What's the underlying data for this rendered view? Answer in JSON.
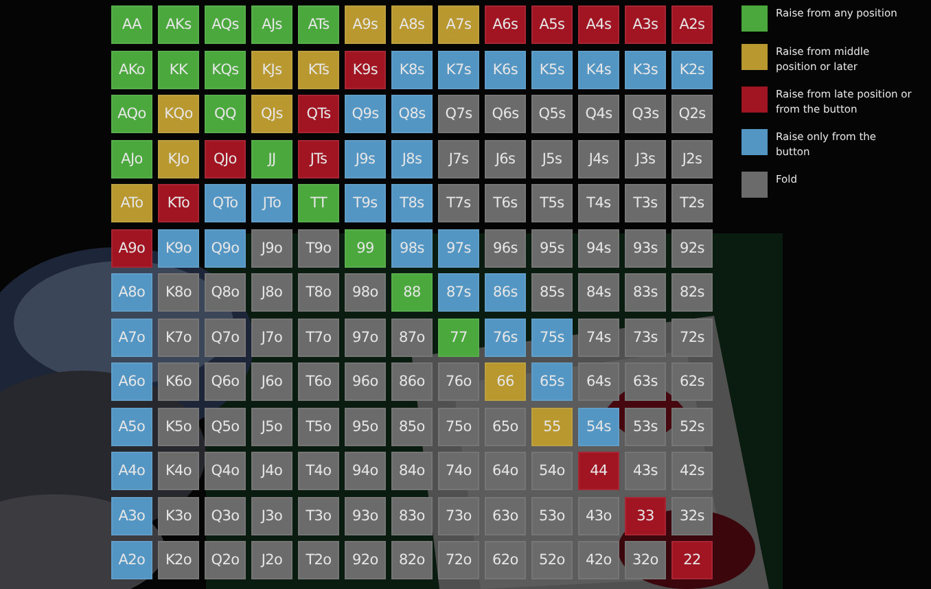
{
  "legend": [
    {
      "label": "Raise from any position",
      "color": "#4aa83d"
    },
    {
      "label": "Raise from middle position or later",
      "color": "#b8982f"
    },
    {
      "label": "Raise from late position or from the button",
      "color": "#a11422"
    },
    {
      "label": "Raise only from the button",
      "color": "#5496c3"
    },
    {
      "label": "Fold",
      "color": "#6b6b6b"
    }
  ],
  "grid": [
    [
      {
        "label": "AA",
        "color": "#4aa83d"
      },
      {
        "label": "AKs",
        "color": "#4aa83d"
      },
      {
        "label": "AQs",
        "color": "#4aa83d"
      },
      {
        "label": "AJs",
        "color": "#4aa83d"
      },
      {
        "label": "ATs",
        "color": "#4aa83d"
      },
      {
        "label": "A9s",
        "color": "#b8982f"
      },
      {
        "label": "A8s",
        "color": "#b8982f"
      },
      {
        "label": "A7s",
        "color": "#b8982f"
      },
      {
        "label": "A6s",
        "color": "#a11422"
      },
      {
        "label": "A5s",
        "color": "#a11422"
      },
      {
        "label": "A4s",
        "color": "#a11422"
      },
      {
        "label": "A3s",
        "color": "#a11422"
      },
      {
        "label": "A2s",
        "color": "#a11422"
      }
    ],
    [
      {
        "label": "AKo",
        "color": "#4aa83d"
      },
      {
        "label": "KK",
        "color": "#4aa83d"
      },
      {
        "label": "KQs",
        "color": "#4aa83d"
      },
      {
        "label": "KJs",
        "color": "#b8982f"
      },
      {
        "label": "KTs",
        "color": "#b8982f"
      },
      {
        "label": "K9s",
        "color": "#a11422"
      },
      {
        "label": "K8s",
        "color": "#5496c3"
      },
      {
        "label": "K7s",
        "color": "#5496c3"
      },
      {
        "label": "K6s",
        "color": "#5496c3"
      },
      {
        "label": "K5s",
        "color": "#5496c3"
      },
      {
        "label": "K4s",
        "color": "#5496c3"
      },
      {
        "label": "K3s",
        "color": "#5496c3"
      },
      {
        "label": "K2s",
        "color": "#5496c3"
      }
    ],
    [
      {
        "label": "AQo",
        "color": "#4aa83d"
      },
      {
        "label": "KQo",
        "color": "#b8982f"
      },
      {
        "label": "QQ",
        "color": "#4aa83d"
      },
      {
        "label": "QJs",
        "color": "#b8982f"
      },
      {
        "label": "QTs",
        "color": "#a11422"
      },
      {
        "label": "Q9s",
        "color": "#5496c3"
      },
      {
        "label": "Q8s",
        "color": "#5496c3"
      },
      {
        "label": "Q7s",
        "color": "#6b6b6b"
      },
      {
        "label": "Q6s",
        "color": "#6b6b6b"
      },
      {
        "label": "Q5s",
        "color": "#6b6b6b"
      },
      {
        "label": "Q4s",
        "color": "#6b6b6b"
      },
      {
        "label": "Q3s",
        "color": "#6b6b6b"
      },
      {
        "label": "Q2s",
        "color": "#6b6b6b"
      }
    ],
    [
      {
        "label": "AJo",
        "color": "#4aa83d"
      },
      {
        "label": "KJo",
        "color": "#b8982f"
      },
      {
        "label": "QJo",
        "color": "#a11422"
      },
      {
        "label": "JJ",
        "color": "#4aa83d"
      },
      {
        "label": "JTs",
        "color": "#a11422"
      },
      {
        "label": "J9s",
        "color": "#5496c3"
      },
      {
        "label": "J8s",
        "color": "#5496c3"
      },
      {
        "label": "J7s",
        "color": "#6b6b6b"
      },
      {
        "label": "J6s",
        "color": "#6b6b6b"
      },
      {
        "label": "J5s",
        "color": "#6b6b6b"
      },
      {
        "label": "J4s",
        "color": "#6b6b6b"
      },
      {
        "label": "J3s",
        "color": "#6b6b6b"
      },
      {
        "label": "J2s",
        "color": "#6b6b6b"
      }
    ],
    [
      {
        "label": "ATo",
        "color": "#b8982f"
      },
      {
        "label": "KTo",
        "color": "#a11422"
      },
      {
        "label": "QTo",
        "color": "#5496c3"
      },
      {
        "label": "JTo",
        "color": "#5496c3"
      },
      {
        "label": "TT",
        "color": "#4aa83d"
      },
      {
        "label": "T9s",
        "color": "#5496c3"
      },
      {
        "label": "T8s",
        "color": "#5496c3"
      },
      {
        "label": "T7s",
        "color": "#6b6b6b"
      },
      {
        "label": "T6s",
        "color": "#6b6b6b"
      },
      {
        "label": "T5s",
        "color": "#6b6b6b"
      },
      {
        "label": "T4s",
        "color": "#6b6b6b"
      },
      {
        "label": "T3s",
        "color": "#6b6b6b"
      },
      {
        "label": "T2s",
        "color": "#6b6b6b"
      }
    ],
    [
      {
        "label": "A9o",
        "color": "#a11422"
      },
      {
        "label": "K9o",
        "color": "#5496c3"
      },
      {
        "label": "Q9o",
        "color": "#5496c3"
      },
      {
        "label": "J9o",
        "color": "#6b6b6b"
      },
      {
        "label": "T9o",
        "color": "#6b6b6b"
      },
      {
        "label": "99",
        "color": "#4aa83d"
      },
      {
        "label": "98s",
        "color": "#5496c3"
      },
      {
        "label": "97s",
        "color": "#5496c3"
      },
      {
        "label": "96s",
        "color": "#6b6b6b"
      },
      {
        "label": "95s",
        "color": "#6b6b6b"
      },
      {
        "label": "94s",
        "color": "#6b6b6b"
      },
      {
        "label": "93s",
        "color": "#6b6b6b"
      },
      {
        "label": "92s",
        "color": "#6b6b6b"
      }
    ],
    [
      {
        "label": "A8o",
        "color": "#5496c3"
      },
      {
        "label": "K8o",
        "color": "#6b6b6b"
      },
      {
        "label": "Q8o",
        "color": "#6b6b6b"
      },
      {
        "label": "J8o",
        "color": "#6b6b6b"
      },
      {
        "label": "T8o",
        "color": "#6b6b6b"
      },
      {
        "label": "98o",
        "color": "#6b6b6b"
      },
      {
        "label": "88",
        "color": "#4aa83d"
      },
      {
        "label": "87s",
        "color": "#5496c3"
      },
      {
        "label": "86s",
        "color": "#5496c3"
      },
      {
        "label": "85s",
        "color": "#6b6b6b"
      },
      {
        "label": "84s",
        "color": "#6b6b6b"
      },
      {
        "label": "83s",
        "color": "#6b6b6b"
      },
      {
        "label": "82s",
        "color": "#6b6b6b"
      }
    ],
    [
      {
        "label": "A7o",
        "color": "#5496c3"
      },
      {
        "label": "K7o",
        "color": "#6b6b6b"
      },
      {
        "label": "Q7o",
        "color": "#6b6b6b"
      },
      {
        "label": "J7o",
        "color": "#6b6b6b"
      },
      {
        "label": "T7o",
        "color": "#6b6b6b"
      },
      {
        "label": "97o",
        "color": "#6b6b6b"
      },
      {
        "label": "87o",
        "color": "#6b6b6b"
      },
      {
        "label": "77",
        "color": "#4aa83d"
      },
      {
        "label": "76s",
        "color": "#5496c3"
      },
      {
        "label": "75s",
        "color": "#5496c3"
      },
      {
        "label": "74s",
        "color": "#6b6b6b"
      },
      {
        "label": "73s",
        "color": "#6b6b6b"
      },
      {
        "label": "72s",
        "color": "#6b6b6b"
      }
    ],
    [
      {
        "label": "A6o",
        "color": "#5496c3"
      },
      {
        "label": "K6o",
        "color": "#6b6b6b"
      },
      {
        "label": "Q6o",
        "color": "#6b6b6b"
      },
      {
        "label": "J6o",
        "color": "#6b6b6b"
      },
      {
        "label": "T6o",
        "color": "#6b6b6b"
      },
      {
        "label": "96o",
        "color": "#6b6b6b"
      },
      {
        "label": "86o",
        "color": "#6b6b6b"
      },
      {
        "label": "76o",
        "color": "#6b6b6b"
      },
      {
        "label": "66",
        "color": "#b8982f"
      },
      {
        "label": "65s",
        "color": "#5496c3"
      },
      {
        "label": "64s",
        "color": "#6b6b6b"
      },
      {
        "label": "63s",
        "color": "#6b6b6b"
      },
      {
        "label": "62s",
        "color": "#6b6b6b"
      }
    ],
    [
      {
        "label": "A5o",
        "color": "#5496c3"
      },
      {
        "label": "K5o",
        "color": "#6b6b6b"
      },
      {
        "label": "Q5o",
        "color": "#6b6b6b"
      },
      {
        "label": "J5o",
        "color": "#6b6b6b"
      },
      {
        "label": "T5o",
        "color": "#6b6b6b"
      },
      {
        "label": "95o",
        "color": "#6b6b6b"
      },
      {
        "label": "85o",
        "color": "#6b6b6b"
      },
      {
        "label": "75o",
        "color": "#6b6b6b"
      },
      {
        "label": "65o",
        "color": "#6b6b6b"
      },
      {
        "label": "55",
        "color": "#b8982f"
      },
      {
        "label": "54s",
        "color": "#5496c3"
      },
      {
        "label": "53s",
        "color": "#6b6b6b"
      },
      {
        "label": "52s",
        "color": "#6b6b6b"
      }
    ],
    [
      {
        "label": "A4o",
        "color": "#5496c3"
      },
      {
        "label": "K4o",
        "color": "#6b6b6b"
      },
      {
        "label": "Q4o",
        "color": "#6b6b6b"
      },
      {
        "label": "J4o",
        "color": "#6b6b6b"
      },
      {
        "label": "T4o",
        "color": "#6b6b6b"
      },
      {
        "label": "94o",
        "color": "#6b6b6b"
      },
      {
        "label": "84o",
        "color": "#6b6b6b"
      },
      {
        "label": "74o",
        "color": "#6b6b6b"
      },
      {
        "label": "64o",
        "color": "#6b6b6b"
      },
      {
        "label": "54o",
        "color": "#6b6b6b"
      },
      {
        "label": "44",
        "color": "#a11422"
      },
      {
        "label": "43s",
        "color": "#6b6b6b"
      },
      {
        "label": "42s",
        "color": "#6b6b6b"
      }
    ],
    [
      {
        "label": "A3o",
        "color": "#5496c3"
      },
      {
        "label": "K3o",
        "color": "#6b6b6b"
      },
      {
        "label": "Q3o",
        "color": "#6b6b6b"
      },
      {
        "label": "J3o",
        "color": "#6b6b6b"
      },
      {
        "label": "T3o",
        "color": "#6b6b6b"
      },
      {
        "label": "93o",
        "color": "#6b6b6b"
      },
      {
        "label": "83o",
        "color": "#6b6b6b"
      },
      {
        "label": "73o",
        "color": "#6b6b6b"
      },
      {
        "label": "63o",
        "color": "#6b6b6b"
      },
      {
        "label": "53o",
        "color": "#6b6b6b"
      },
      {
        "label": "43o",
        "color": "#6b6b6b"
      },
      {
        "label": "33",
        "color": "#a11422"
      },
      {
        "label": "32s",
        "color": "#6b6b6b"
      }
    ],
    [
      {
        "label": "A2o",
        "color": "#5496c3"
      },
      {
        "label": "K2o",
        "color": "#6b6b6b"
      },
      {
        "label": "Q2o",
        "color": "#6b6b6b"
      },
      {
        "label": "J2o",
        "color": "#6b6b6b"
      },
      {
        "label": "T2o",
        "color": "#6b6b6b"
      },
      {
        "label": "92o",
        "color": "#6b6b6b"
      },
      {
        "label": "82o",
        "color": "#6b6b6b"
      },
      {
        "label": "72o",
        "color": "#6b6b6b"
      },
      {
        "label": "62o",
        "color": "#6b6b6b"
      },
      {
        "label": "52o",
        "color": "#6b6b6b"
      },
      {
        "label": "42o",
        "color": "#6b6b6b"
      },
      {
        "label": "32o",
        "color": "#6b6b6b"
      },
      {
        "label": "22",
        "color": "#a11422"
      }
    ]
  ]
}
